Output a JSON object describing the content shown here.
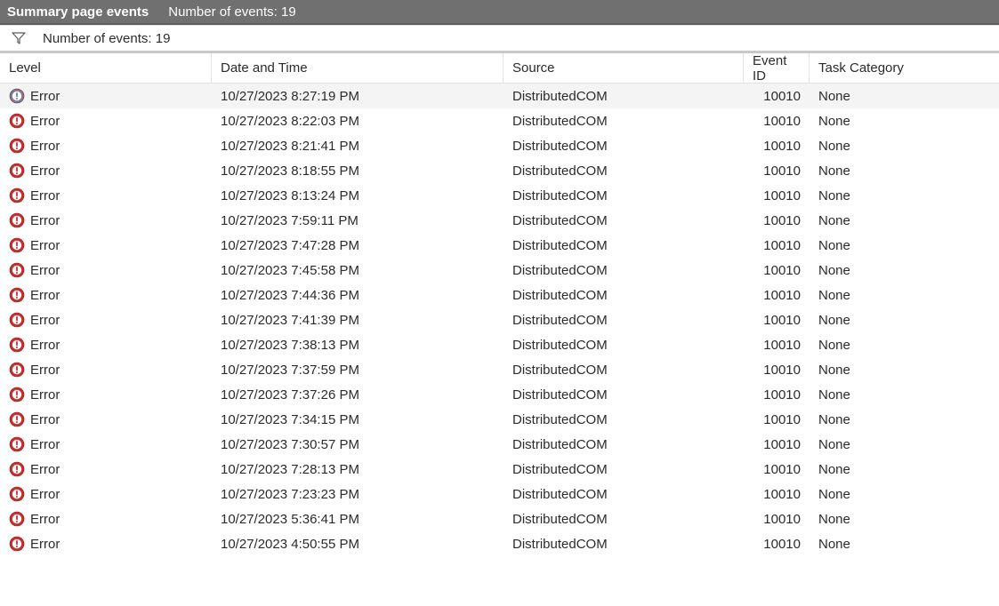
{
  "titlebar": {
    "title": "Summary page events",
    "count_label": "Number of events: 19"
  },
  "filterbar": {
    "count_label": "Number of events: 19"
  },
  "columns": {
    "level": "Level",
    "date": "Date and Time",
    "source": "Source",
    "eventid": "Event ID",
    "task": "Task Category"
  },
  "rows": [
    {
      "level": "Error",
      "date": "10/27/2023 8:27:19 PM",
      "source": "DistributedCOM",
      "eventid": "10010",
      "task": "None",
      "selected": true
    },
    {
      "level": "Error",
      "date": "10/27/2023 8:22:03 PM",
      "source": "DistributedCOM",
      "eventid": "10010",
      "task": "None"
    },
    {
      "level": "Error",
      "date": "10/27/2023 8:21:41 PM",
      "source": "DistributedCOM",
      "eventid": "10010",
      "task": "None"
    },
    {
      "level": "Error",
      "date": "10/27/2023 8:18:55 PM",
      "source": "DistributedCOM",
      "eventid": "10010",
      "task": "None"
    },
    {
      "level": "Error",
      "date": "10/27/2023 8:13:24 PM",
      "source": "DistributedCOM",
      "eventid": "10010",
      "task": "None"
    },
    {
      "level": "Error",
      "date": "10/27/2023 7:59:11 PM",
      "source": "DistributedCOM",
      "eventid": "10010",
      "task": "None"
    },
    {
      "level": "Error",
      "date": "10/27/2023 7:47:28 PM",
      "source": "DistributedCOM",
      "eventid": "10010",
      "task": "None"
    },
    {
      "level": "Error",
      "date": "10/27/2023 7:45:58 PM",
      "source": "DistributedCOM",
      "eventid": "10010",
      "task": "None"
    },
    {
      "level": "Error",
      "date": "10/27/2023 7:44:36 PM",
      "source": "DistributedCOM",
      "eventid": "10010",
      "task": "None"
    },
    {
      "level": "Error",
      "date": "10/27/2023 7:41:39 PM",
      "source": "DistributedCOM",
      "eventid": "10010",
      "task": "None"
    },
    {
      "level": "Error",
      "date": "10/27/2023 7:38:13 PM",
      "source": "DistributedCOM",
      "eventid": "10010",
      "task": "None"
    },
    {
      "level": "Error",
      "date": "10/27/2023 7:37:59 PM",
      "source": "DistributedCOM",
      "eventid": "10010",
      "task": "None"
    },
    {
      "level": "Error",
      "date": "10/27/2023 7:37:26 PM",
      "source": "DistributedCOM",
      "eventid": "10010",
      "task": "None"
    },
    {
      "level": "Error",
      "date": "10/27/2023 7:34:15 PM",
      "source": "DistributedCOM",
      "eventid": "10010",
      "task": "None"
    },
    {
      "level": "Error",
      "date": "10/27/2023 7:30:57 PM",
      "source": "DistributedCOM",
      "eventid": "10010",
      "task": "None"
    },
    {
      "level": "Error",
      "date": "10/27/2023 7:28:13 PM",
      "source": "DistributedCOM",
      "eventid": "10010",
      "task": "None"
    },
    {
      "level": "Error",
      "date": "10/27/2023 7:23:23 PM",
      "source": "DistributedCOM",
      "eventid": "10010",
      "task": "None"
    },
    {
      "level": "Error",
      "date": "10/27/2023 5:36:41 PM",
      "source": "DistributedCOM",
      "eventid": "10010",
      "task": "None"
    },
    {
      "level": "Error",
      "date": "10/27/2023 4:50:55 PM",
      "source": "DistributedCOM",
      "eventid": "10010",
      "task": "None"
    }
  ]
}
